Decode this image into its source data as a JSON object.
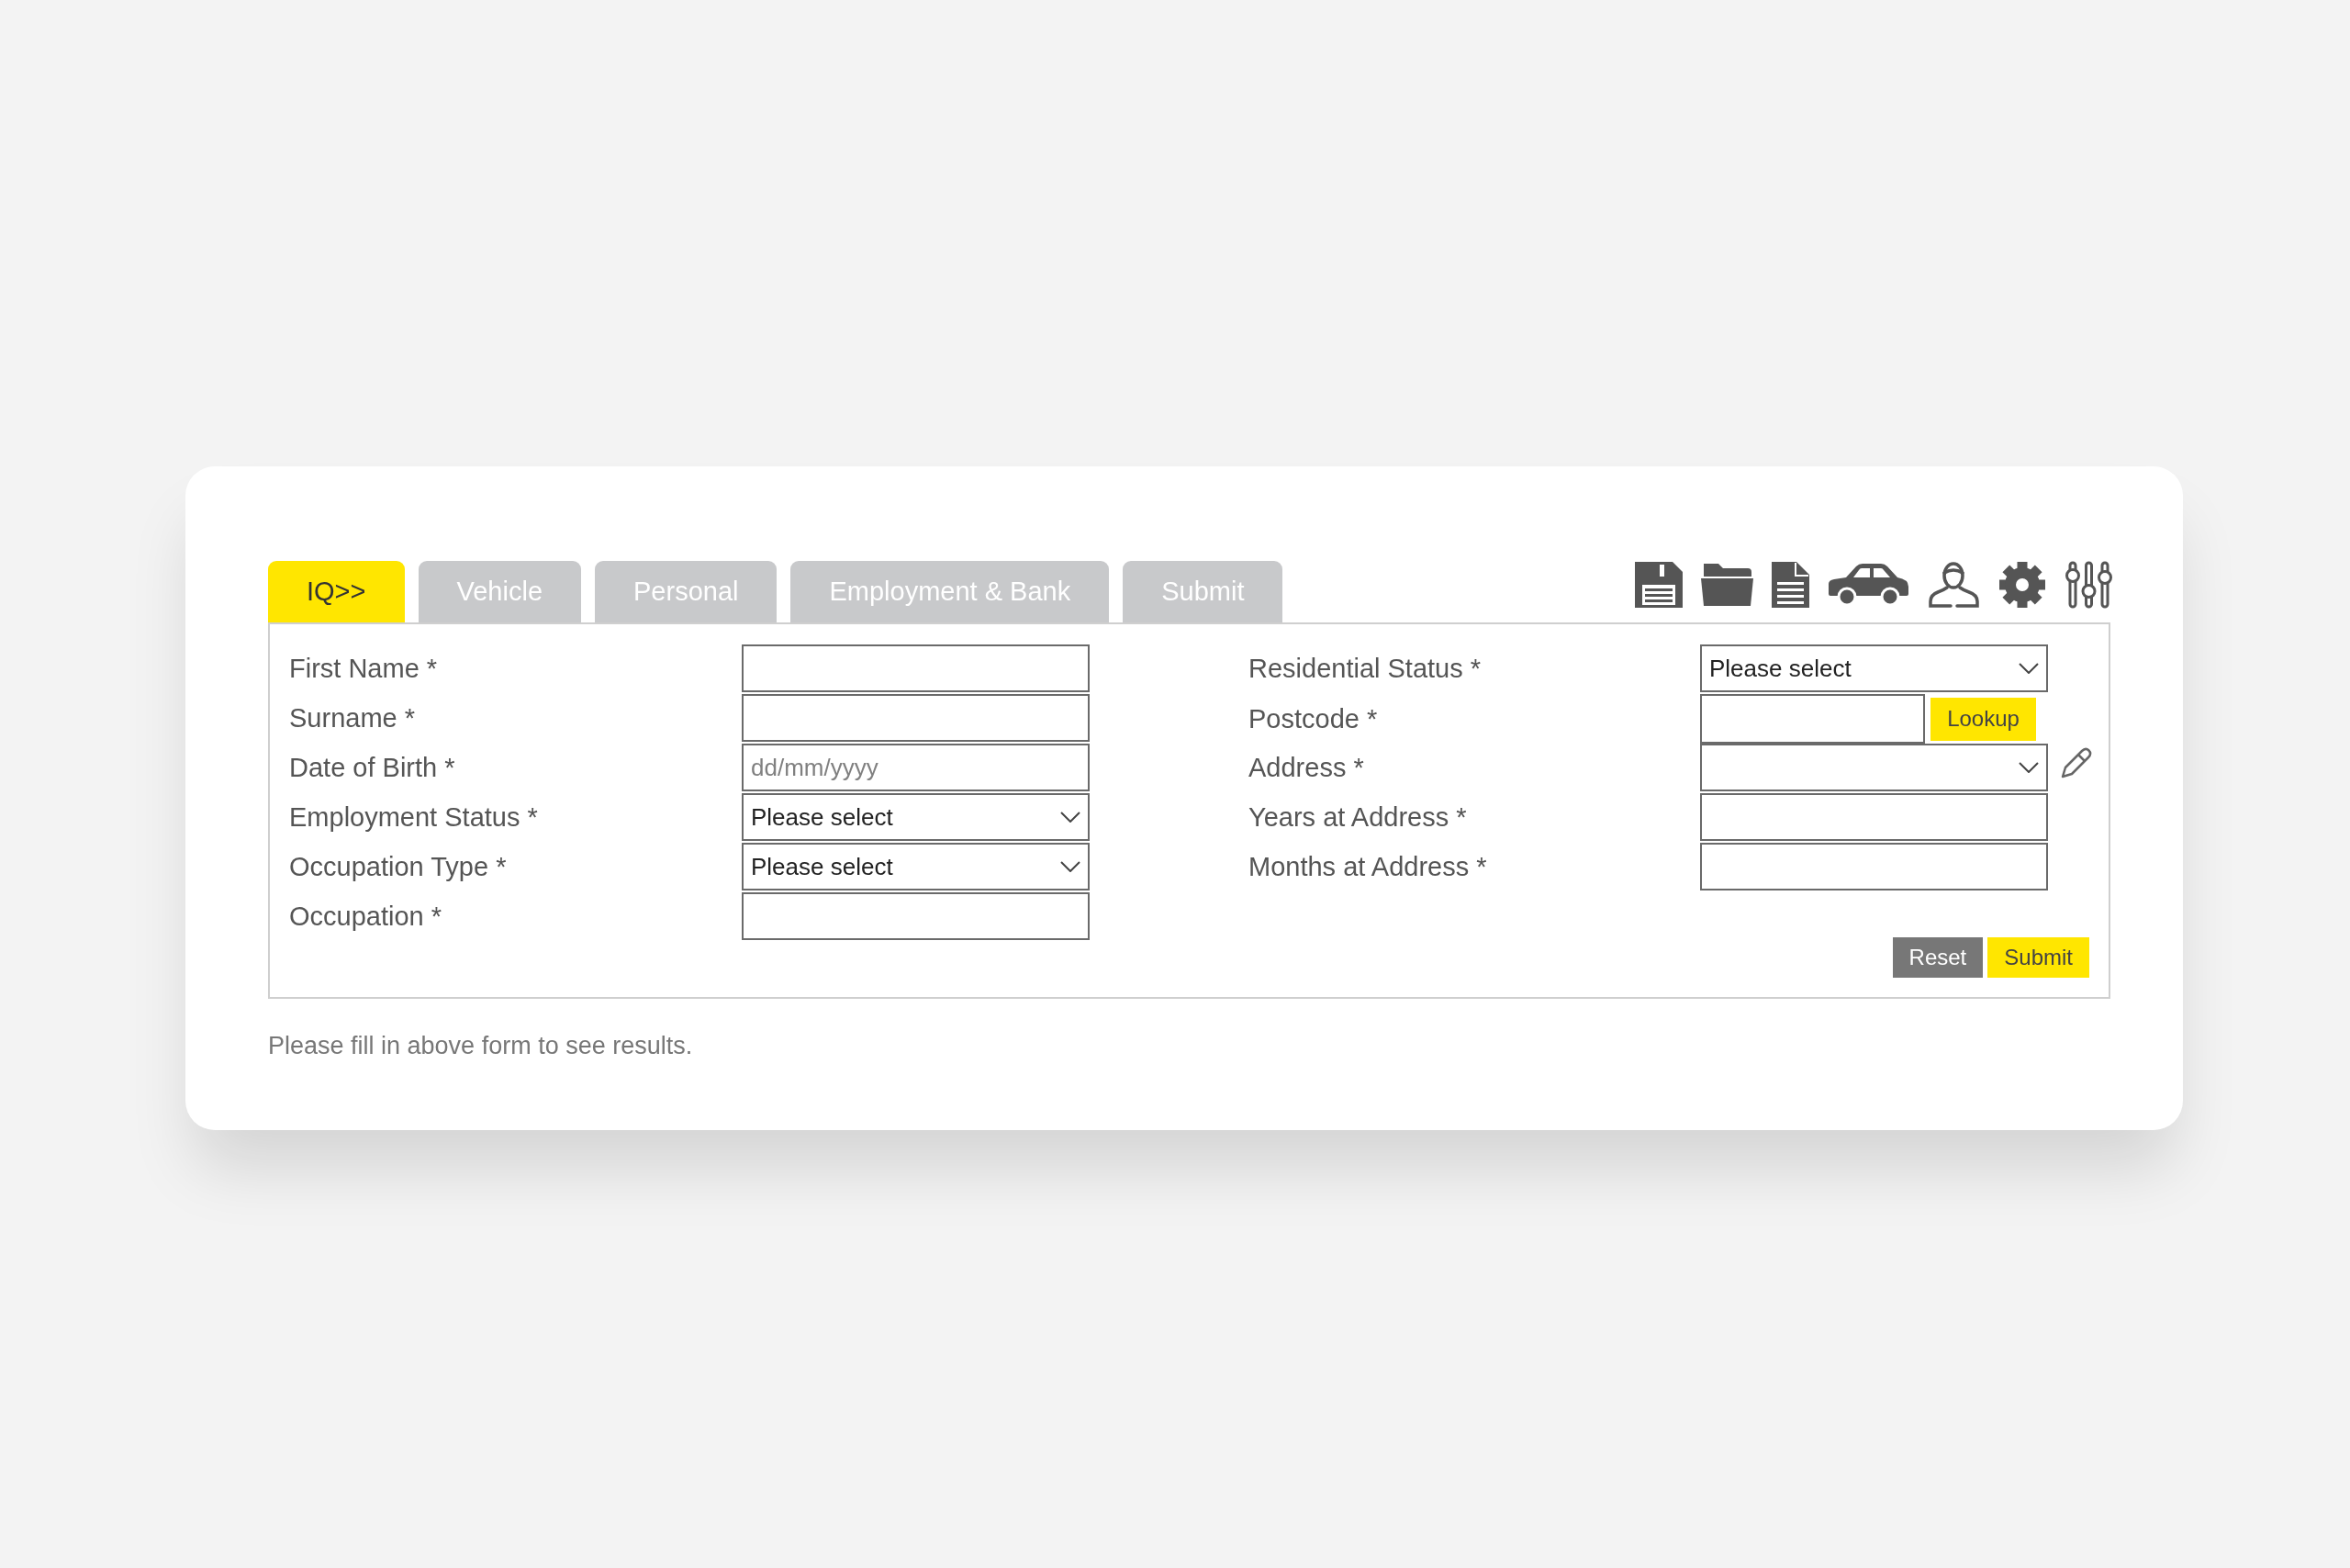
{
  "tabs": [
    {
      "label": "IQ>>",
      "selected": true
    },
    {
      "label": "Vehicle",
      "selected": false
    },
    {
      "label": "Personal",
      "selected": false
    },
    {
      "label": "Employment & Bank",
      "selected": false
    },
    {
      "label": "Submit",
      "selected": false
    }
  ],
  "applicant_fields": [
    {
      "label": "First Name *",
      "kind": "text"
    },
    {
      "label": "Surname *",
      "kind": "text"
    },
    {
      "label": "Date of Birth *",
      "kind": "text",
      "placeholder": "dd/mm/yyyy"
    },
    {
      "label": "Employment Status *",
      "kind": "select",
      "value": "Please select"
    },
    {
      "label": "Occupation Type *",
      "kind": "select",
      "value": "Please select"
    },
    {
      "label": "Occupation *",
      "kind": "text"
    }
  ],
  "address_fields": [
    {
      "label": "Residential Status *",
      "kind": "select",
      "value": "Please select",
      "editable": false
    },
    {
      "label": "Postcode *",
      "kind": "text",
      "action": "Lookup",
      "editable": false
    },
    {
      "label": "Address *",
      "kind": "select",
      "editable": true
    },
    {
      "label": "Years at Address *",
      "kind": "text",
      "editable": false
    },
    {
      "label": "Months at Address *",
      "kind": "text",
      "editable": false
    }
  ],
  "form_buttons": [
    {
      "label": "Reset",
      "kind": "reset"
    },
    {
      "label": "Submit",
      "kind": "submit"
    }
  ],
  "message": "Please fill in above form to see results."
}
